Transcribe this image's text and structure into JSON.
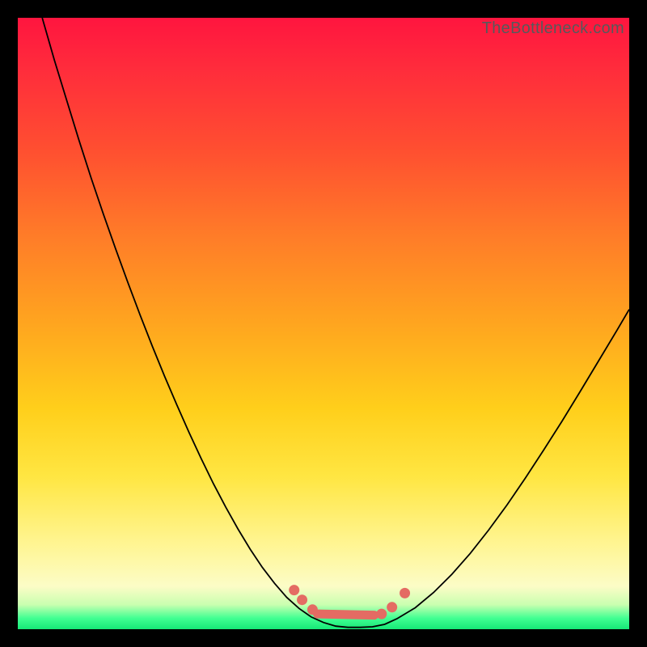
{
  "watermark": "TheBottleneck.com",
  "chart_data": {
    "type": "line",
    "title": "",
    "xlabel": "",
    "ylabel": "",
    "xlim": [
      0,
      100
    ],
    "ylim": [
      0,
      100
    ],
    "grid": false,
    "legend": false,
    "background_gradient": {
      "top": "#ff153f",
      "mid": "#ffcf1b",
      "bottom": "#16e877"
    },
    "series": [
      {
        "name": "bottleneck-curve",
        "x": [
          4,
          6,
          8,
          10,
          12,
          14,
          16,
          18,
          20,
          22,
          24,
          26,
          28,
          30,
          32,
          34,
          36,
          38,
          40,
          42,
          44,
          46,
          48,
          50,
          52,
          54,
          56,
          58,
          60,
          62,
          65,
          68,
          71,
          74,
          77,
          80,
          83,
          86,
          89,
          92,
          95,
          98,
          100
        ],
        "values": [
          100,
          93,
          86.5,
          80,
          73.8,
          67.9,
          62.2,
          56.7,
          51.4,
          46.3,
          41.4,
          36.7,
          32.2,
          27.9,
          23.8,
          20,
          16.4,
          13.1,
          10.1,
          7.5,
          5.2,
          3.4,
          2,
          1.1,
          0.5,
          0.3,
          0.3,
          0.4,
          0.8,
          1.7,
          3.5,
          6,
          9,
          12.4,
          16.2,
          20.3,
          24.7,
          29.3,
          34,
          38.9,
          43.9,
          48.9,
          52.3
        ]
      }
    ],
    "markers": {
      "points": [
        {
          "x": 45.2,
          "y": 6.4
        },
        {
          "x": 46.5,
          "y": 4.8
        },
        {
          "x": 48.2,
          "y": 3.2
        },
        {
          "x": 59.5,
          "y": 2.5
        },
        {
          "x": 61.2,
          "y": 3.6
        },
        {
          "x": 63.3,
          "y": 5.9
        }
      ],
      "segments": [
        {
          "x1": 49.0,
          "y1": 2.5,
          "x2": 58.3,
          "y2": 2.3
        }
      ],
      "color": "#e46b63"
    }
  }
}
